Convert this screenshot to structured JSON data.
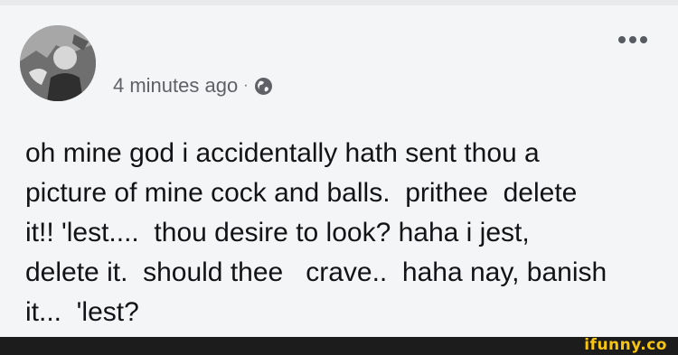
{
  "post": {
    "timestamp": "4 minutes ago",
    "separator": "·",
    "privacy_icon": "globe-icon",
    "menu_icon": "more-dots-icon",
    "text": "oh mine god i accidentally hath sent thou a\npicture of mine cock and balls.  prithee  delete\nit!! 'lest....  thou desire to look? haha i jest,\ndelete it.  should thee   crave..  haha nay, banish\nit...  'lest?"
  },
  "watermark": {
    "text": "ifunny.co",
    "color": "#f7c40f"
  },
  "colors": {
    "background": "#f4f5f7",
    "text": "#121316",
    "meta_text": "#5f6167",
    "footer": "#1c1c1c"
  }
}
